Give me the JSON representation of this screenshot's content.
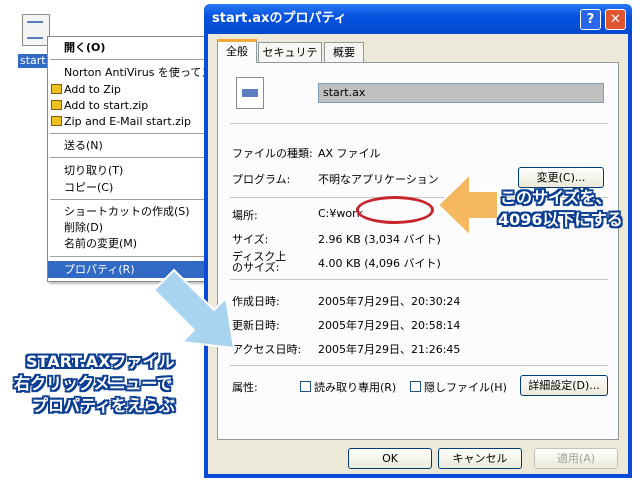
{
  "desktop": {
    "icon_label": "start.ax"
  },
  "context_menu": {
    "items": [
      "開く(O)",
      "Norton AntiVirus を使ってスキャン",
      "Add to Zip",
      "Add to start.zip",
      "Zip and E-Mail start.zip",
      "送る(N)",
      "切り取り(T)",
      "コピー(C)",
      "ショートカットの作成(S)",
      "削除(D)",
      "名前の変更(M)",
      "プロパティ(R)"
    ]
  },
  "dialog": {
    "title": "start.axのプロパティ",
    "help_glyph": "?",
    "close_glyph": "✕",
    "tabs": [
      "全般",
      "セキュリティ",
      "概要"
    ],
    "file_name": "start.ax",
    "fields": {
      "type_label": "ファイルの種類:",
      "type_value": "AX ファイル",
      "program_label": "プログラム:",
      "program_value": "不明なアプリケーション",
      "change_button": "変更(C)...",
      "location_label": "場所:",
      "location_value": "C:¥work",
      "size_label": "サイズ:",
      "size_value": "2.96 KB (3,034 バイト)",
      "disk_size_label_1": "ディスク上",
      "disk_size_label_2": "のサイズ:",
      "disk_size_value": "4.00 KB (4,096 バイト)",
      "created_label": "作成日時:",
      "created_value": "2005年7月29日、20:30:24",
      "modified_label": "更新日時:",
      "modified_value": "2005年7月29日、20:58:14",
      "accessed_label": "アクセス日時:",
      "accessed_value": "2005年7月29日、21:26:45",
      "attributes_label": "属性:",
      "readonly_label": "読み取り専用(R)",
      "hidden_label": "隠しファイル(H)",
      "advanced_button": "詳細設定(D)..."
    },
    "buttons": {
      "ok": "OK",
      "cancel": "キャンセル",
      "apply": "適用(A)"
    }
  },
  "annotations": {
    "right_callout_1": "このサイズを、",
    "right_callout_2": "4096以下にする",
    "left_callout_1": "START.AXファイル",
    "left_callout_2": "右クリックメニューで",
    "left_callout_3": "プロパティをえらぶ",
    "colors": {
      "arrow_orange": "#f5b860",
      "arrow_blue": "#a8d4f0",
      "ellipse_red": "#c8242c"
    }
  }
}
